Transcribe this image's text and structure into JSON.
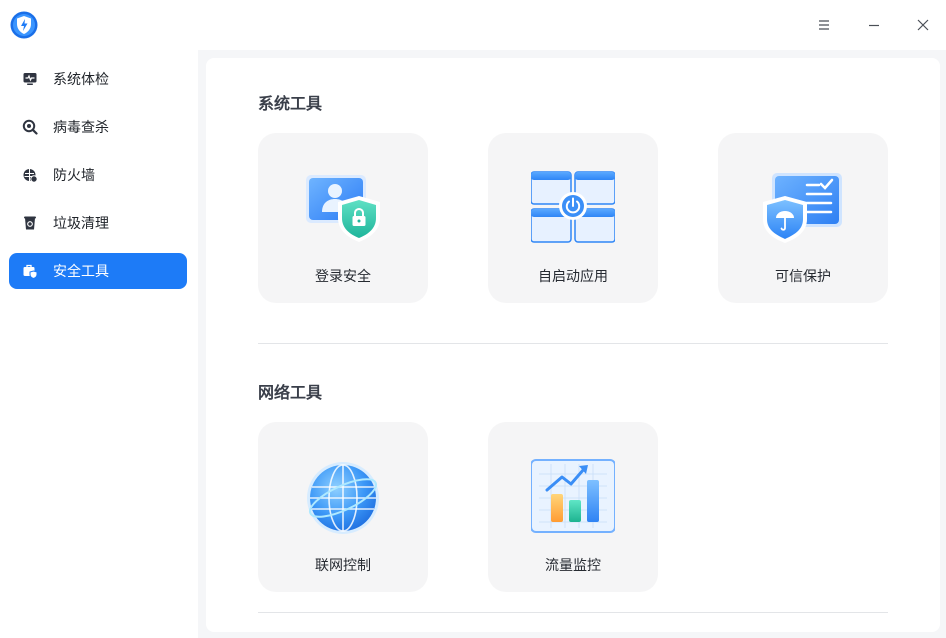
{
  "window": {
    "controls": [
      {
        "name": "menu-button",
        "icon": "menu-icon"
      },
      {
        "name": "minimize-button",
        "icon": "minimize-icon"
      },
      {
        "name": "close-button",
        "icon": "close-icon"
      }
    ]
  },
  "sidebar": {
    "items": [
      {
        "label": "系统体检",
        "icon": "monitor-pulse-icon",
        "active": false
      },
      {
        "label": "病毒查杀",
        "icon": "virus-scan-icon",
        "active": false
      },
      {
        "label": "防火墙",
        "icon": "firewall-icon",
        "active": false
      },
      {
        "label": "垃圾清理",
        "icon": "trash-clean-icon",
        "active": false
      },
      {
        "label": "安全工具",
        "icon": "toolbox-shield-icon",
        "active": true
      }
    ]
  },
  "main": {
    "sections": [
      {
        "title": "系统工具",
        "cards": [
          {
            "label": "登录安全",
            "icon": "login-security-icon"
          },
          {
            "label": "自启动应用",
            "icon": "autostart-apps-icon"
          },
          {
            "label": "可信保护",
            "icon": "trusted-protection-icon"
          }
        ]
      },
      {
        "title": "网络工具",
        "cards": [
          {
            "label": "联网控制",
            "icon": "network-control-globe-icon"
          },
          {
            "label": "流量监控",
            "icon": "traffic-monitor-chart-icon"
          }
        ]
      }
    ]
  },
  "colors": {
    "accent": "#1d7bf7",
    "shield_green": "#2bc4a8",
    "card_bg": "#f5f5f6"
  }
}
